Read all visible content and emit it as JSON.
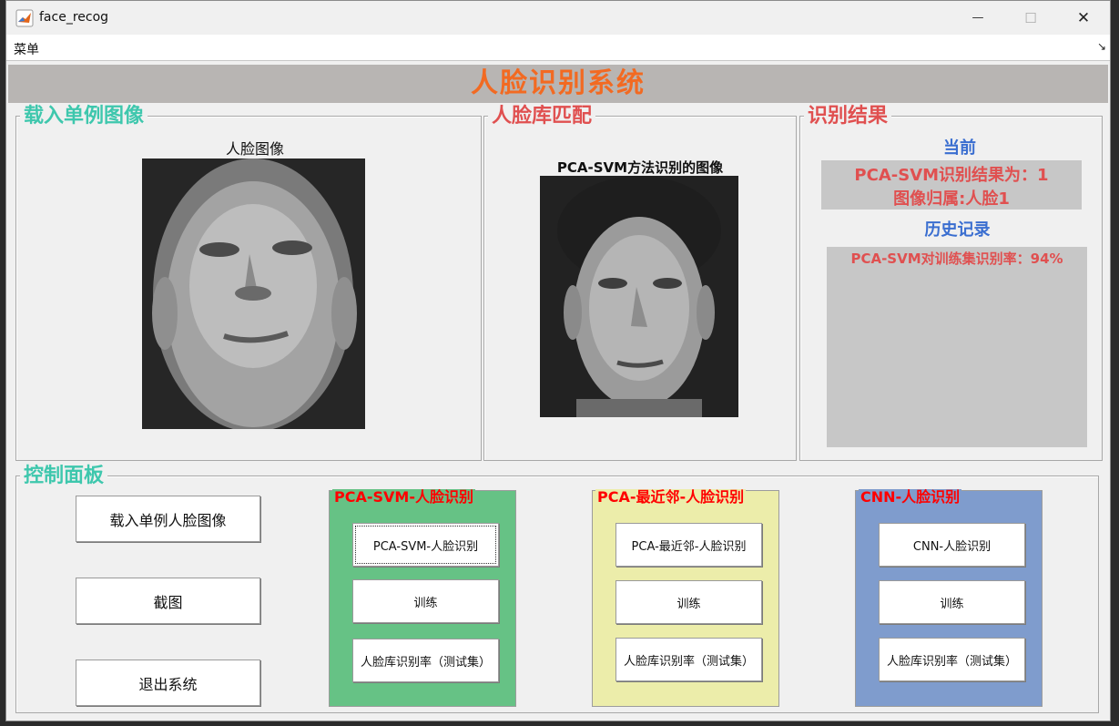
{
  "window": {
    "title": "face_recog",
    "controls": {
      "minimize": "—",
      "maximize": "☐",
      "close": "✕"
    }
  },
  "menu": {
    "item": "菜单",
    "arrow": "↘"
  },
  "system_title": "人脸识别系统",
  "load_panel": {
    "legend": "载入单例图像",
    "image_title": "人脸图像"
  },
  "match_panel": {
    "legend": "人脸库匹配",
    "image_title": "PCA-SVM方法识别的图像"
  },
  "result_panel": {
    "legend": "识别结果",
    "current_label": "当前",
    "current_line1": "PCA-SVM识别结果为：1",
    "current_line2": "图像归属:人脸1",
    "history_label": "历史记录",
    "history_text": "PCA-SVM对训练集识别率：94%"
  },
  "control_panel": {
    "legend": "控制面板",
    "buttons": [
      "载入单例人脸图像",
      "截图",
      "退出系统"
    ]
  },
  "groups": [
    {
      "title": "PCA-SVM-人脸识别",
      "color": "#66c285",
      "buttons": [
        "PCA-SVM-人脸识别",
        "训练",
        "人脸库识别率（测试集）"
      ]
    },
    {
      "title": "PCA-最近邻-人脸识别",
      "color": "#ecedaa",
      "buttons": [
        "PCA-最近邻-人脸识别",
        "训练",
        "人脸库识别率（测试集）"
      ]
    },
    {
      "title": "CNN-人脸识别",
      "color": "#7f9ccd",
      "buttons": [
        "CNN-人脸识别",
        "训练",
        "人脸库识别率（测试集）"
      ]
    }
  ]
}
